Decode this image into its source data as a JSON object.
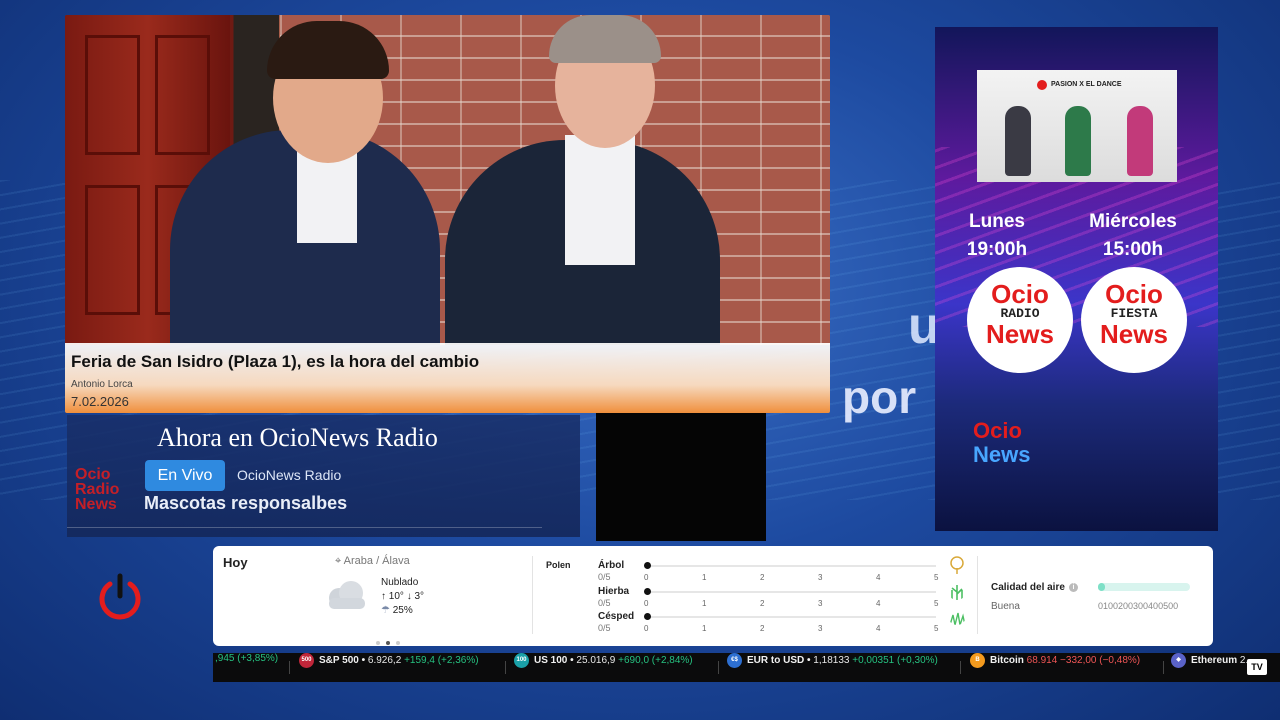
{
  "background": {
    "overlay_text_1": "u",
    "overlay_text_2": "por"
  },
  "news": {
    "title": "Feria de San Isidro (Plaza 1), es la hora del cambio",
    "author": "Antonio Lorca",
    "date": "7.02.2026"
  },
  "now_playing": {
    "heading": "Ahora en OcioNews Radio",
    "logo_text": "Ocio Radio News",
    "live_label": "En Vivo",
    "station": "OcioNews Radio",
    "show": "Mascotas responsalbes"
  },
  "promo": {
    "image_label": "PASION X EL DANCE",
    "left_day": "Lunes",
    "left_time": "19:00h",
    "right_day": "Miércoles",
    "right_time": "15:00h",
    "badge_ocio": "Ocio",
    "badge_left_sub": "RADIO",
    "badge_right_sub": "FIESTA",
    "badge_news": "News",
    "logo_ocio": "Ocio",
    "logo_news": "News"
  },
  "weather": {
    "today_label": "Hoy",
    "location": "Araba / Álava",
    "condition": "Nublado",
    "temp_high": "10°",
    "temp_low": "3°",
    "rain": "25%",
    "icon": "cloud-icon",
    "pollen_title": "Polen",
    "pollen": [
      {
        "name": "Árbol",
        "value": "0/5",
        "level": 0,
        "icon": "tree-icon"
      },
      {
        "name": "Hierba",
        "value": "0/5",
        "level": 0,
        "icon": "grass-icon"
      },
      {
        "name": "Césped",
        "value": "0/5",
        "level": 0,
        "icon": "lawn-icon"
      }
    ],
    "pollen_ticks": [
      "0",
      "1",
      "2",
      "3",
      "4",
      "5"
    ],
    "air_quality_title": "Calidad del aire",
    "air_quality_status": "Buena",
    "air_quality_scale": "0100200300400500"
  },
  "ticker": {
    "first_tail": ",945 (+3,85%)",
    "items": [
      {
        "badge": "500",
        "name": "S&P 500",
        "value": "6.926,2",
        "change": "+159,4 (+2,36%)",
        "dir": "up"
      },
      {
        "badge": "100",
        "name": "US 100",
        "value": "25.016,9",
        "change": "+690,0 (+2,84%)",
        "dir": "up"
      },
      {
        "badge": "€$",
        "name": "EUR to USD",
        "value": "1,18133",
        "change": "+0,00351 (+0,30%)",
        "dir": "up"
      },
      {
        "badge": "B",
        "name": "Bitcoin",
        "value": "68.914",
        "change": "−332,00 (−0,48%)",
        "dir": "down"
      },
      {
        "badge": "◆",
        "name": "Ethereum",
        "value": "2.",
        "change": "",
        "dir": "down"
      }
    ]
  },
  "colors": {
    "accent_red": "#e31d1d",
    "live_blue": "#2f8ae0",
    "ticker_up": "#26c281",
    "ticker_down": "#f05656"
  }
}
